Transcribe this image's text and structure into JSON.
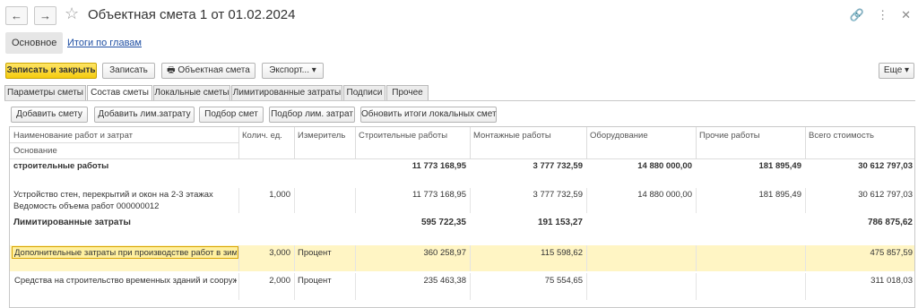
{
  "header": {
    "title": "Объектная смета 1 от 01.02.2024",
    "back_glyph": "←",
    "forward_glyph": "→",
    "icons": [
      "favorite-star-icon",
      "link-icon",
      "more-icon",
      "close-icon"
    ]
  },
  "subnav": {
    "main": "Основное",
    "link": "Итоги по главам"
  },
  "commands": {
    "save_close": "Записать и закрыть",
    "save": "Записать",
    "object_estimate": "Объектная смета",
    "export": "Экспорт...",
    "more": "Еще"
  },
  "tabs": [
    "Параметры сметы",
    "Состав сметы",
    "Локальные сметы",
    "Лимитированные затраты",
    "Подписи",
    "Прочее"
  ],
  "tab_active_index": 1,
  "toolbar": {
    "add_estimate": "Добавить смету",
    "add_limit_cost": "Добавить лим.затрату",
    "select_estimates": "Подбор смет",
    "select_limit_costs": "Подбор лим. затрат",
    "update_totals": "Обновить итоги локальных смет"
  },
  "table": {
    "columns": {
      "name": "Наименование работ и затрат",
      "basis": "Основание",
      "qty": "Колич. ед.",
      "unit": "Измеритель",
      "construction": "Строительные работы",
      "installation": "Монтажные работы",
      "equipment": "Оборудование",
      "other": "Прочие работы",
      "total": "Всего стоимость"
    },
    "rows": [
      {
        "name": "строительные работы",
        "construction": "11 773 168,95",
        "installation": "3 777 732,59",
        "equipment": "14 880 000,00",
        "other": "181 895,49",
        "total": "30 612 797,03"
      },
      {
        "name": "Устройство стен, перекрытий и окон на 2-3 этажах",
        "basis": "Ведомость объема работ 000000012",
        "qty": "1,000",
        "construction": "11 773 168,95",
        "installation": "3 777 732,59",
        "equipment": "14 880 000,00",
        "other": "181 895,49",
        "total": "30 612 797,03"
      },
      {
        "name": "Лимитированные затраты",
        "construction": "595 722,35",
        "installation": "191 153,27",
        "total": "786 875,62"
      },
      {
        "name": "Дополнительные затраты при производстве работ в зим...",
        "qty": "3,000",
        "unit": "Процент",
        "construction": "360 258,97",
        "installation": "115 598,62",
        "total": "475 857,59"
      },
      {
        "name": "Средства на строительство временных зданий и сооруж...",
        "qty": "2,000",
        "unit": "Процент",
        "construction": "235 463,38",
        "installation": "75 554,65",
        "total": "311 018,03"
      }
    ]
  },
  "colors": {
    "primary_button": "#f5cc0f",
    "selected_row": "#fff5c4",
    "link": "#1f4fa3"
  }
}
